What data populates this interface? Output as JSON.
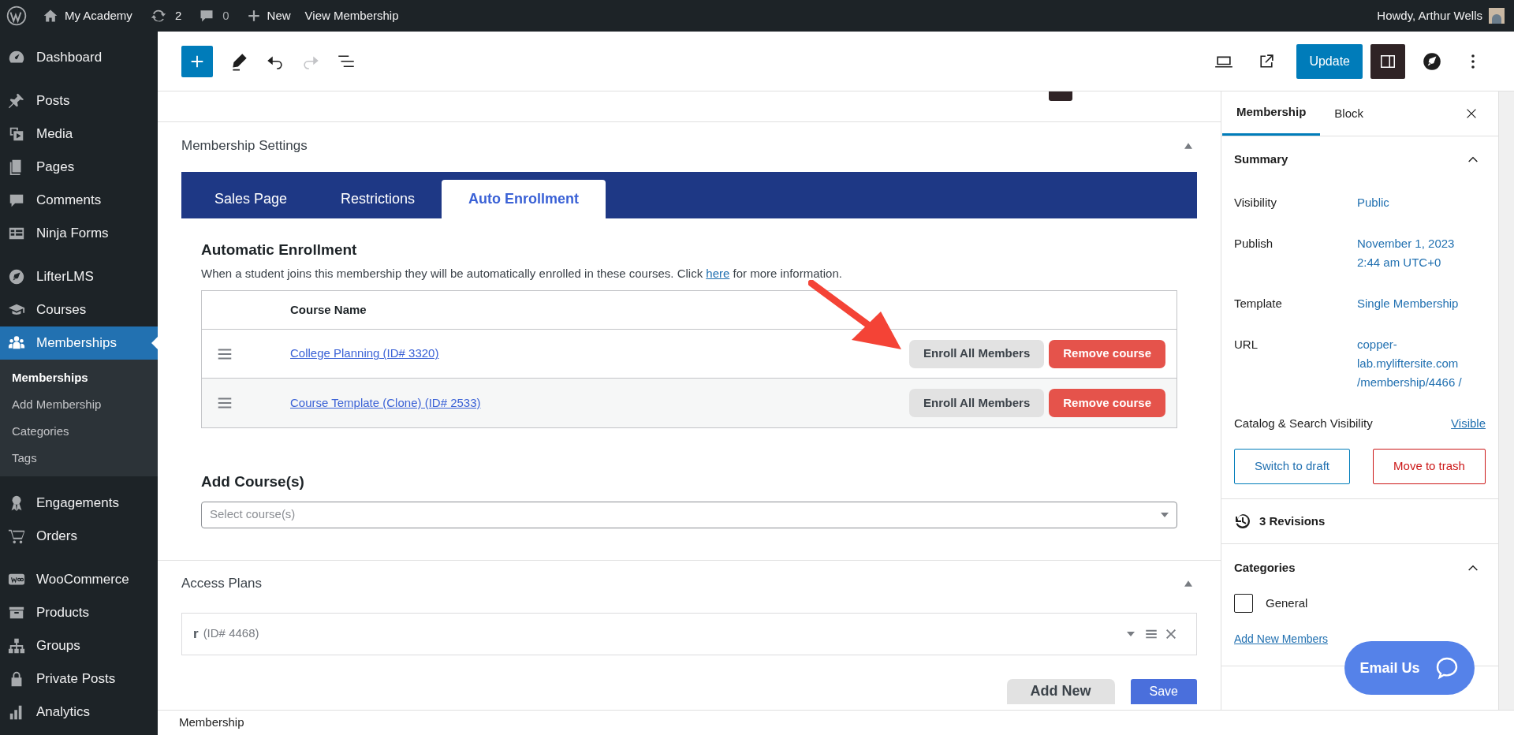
{
  "admin_bar": {
    "site": "My Academy",
    "updates": "2",
    "comments": "0",
    "new": "New",
    "view": "View Membership",
    "greeting": "Howdy, Arthur Wells"
  },
  "sidebar": {
    "items": [
      {
        "label": "Dashboard",
        "selected": false
      },
      {
        "label": "Posts",
        "selected": false
      },
      {
        "label": "Media",
        "selected": false
      },
      {
        "label": "Pages",
        "selected": false
      },
      {
        "label": "Comments",
        "selected": false
      },
      {
        "label": "Ninja Forms",
        "selected": false
      },
      {
        "label": "LifterLMS",
        "selected": false
      },
      {
        "label": "Courses",
        "selected": false
      },
      {
        "label": "Memberships",
        "selected": true,
        "children": [
          {
            "label": "Memberships",
            "selected": true
          },
          {
            "label": "Add Membership",
            "selected": false
          },
          {
            "label": "Categories",
            "selected": false
          },
          {
            "label": "Tags",
            "selected": false
          }
        ]
      },
      {
        "label": "Engagements",
        "selected": false
      },
      {
        "label": "Orders",
        "selected": false
      },
      {
        "label": "WooCommerce",
        "selected": false
      },
      {
        "label": "Products",
        "selected": false
      },
      {
        "label": "Groups",
        "selected": false
      },
      {
        "label": "Private Posts",
        "selected": false
      },
      {
        "label": "Analytics",
        "selected": false
      }
    ]
  },
  "toolbar": {
    "update": "Update"
  },
  "membership_settings": {
    "title": "Membership Settings",
    "expanded": true,
    "tabs": [
      {
        "label": "Sales Page",
        "selected": false
      },
      {
        "label": "Restrictions",
        "selected": false
      },
      {
        "label": "Auto Enrollment",
        "selected": true
      }
    ],
    "heading": "Automatic Enrollment",
    "description": "When a student joins this membership they will be automatically enrolled in these courses. Click",
    "link": "here",
    "description_end": "for more information.",
    "table": {
      "columns": [
        "Course Name"
      ],
      "rows": [
        {
          "course": "College Planning (ID# 3320)",
          "enroll": "Enroll All Members",
          "remove": "Remove course"
        },
        {
          "course": "Course Template (Clone) (ID# 2533)",
          "enroll": "Enroll All Members",
          "remove": "Remove course"
        }
      ]
    },
    "add_heading": "Add Course(s)",
    "select": {
      "placeholder": "Select course(s)"
    }
  },
  "access_plans": {
    "title": "Access Plans",
    "expanded": true,
    "plans": [
      {
        "name": "r",
        "id": "(ID# 4468)"
      }
    ],
    "add_new": "Add New",
    "save": "Save"
  },
  "footer": "Membership",
  "panel": {
    "tabs": [
      {
        "label": "Membership",
        "selected": true
      },
      {
        "label": "Block",
        "selected": false
      }
    ],
    "summary": {
      "title": "Summary",
      "expanded": true,
      "rows": [
        {
          "label": "Visibility",
          "value": "Public",
          "kind": "link"
        },
        {
          "label": "Publish",
          "value": "November 1, 2023 2:44 am UTC+0",
          "kind": "link"
        },
        {
          "label": "Template",
          "value": "Single Membership",
          "kind": "link"
        },
        {
          "label": "URL",
          "value": "copper-lab.myliftersite.com /membership/4466 /",
          "kind": "link"
        },
        {
          "label": "Catalog & Search Visibility",
          "value": "Visible",
          "kind": "underlined"
        }
      ],
      "draft": "Switch to draft",
      "trash": "Move to trash"
    },
    "revisions": "3 Revisions",
    "categories": {
      "title": "Categories",
      "expanded": true,
      "items": [
        {
          "label": "General",
          "checked": false
        }
      ],
      "add_link": "Add New Members"
    }
  },
  "chat_button": "Email Us"
}
